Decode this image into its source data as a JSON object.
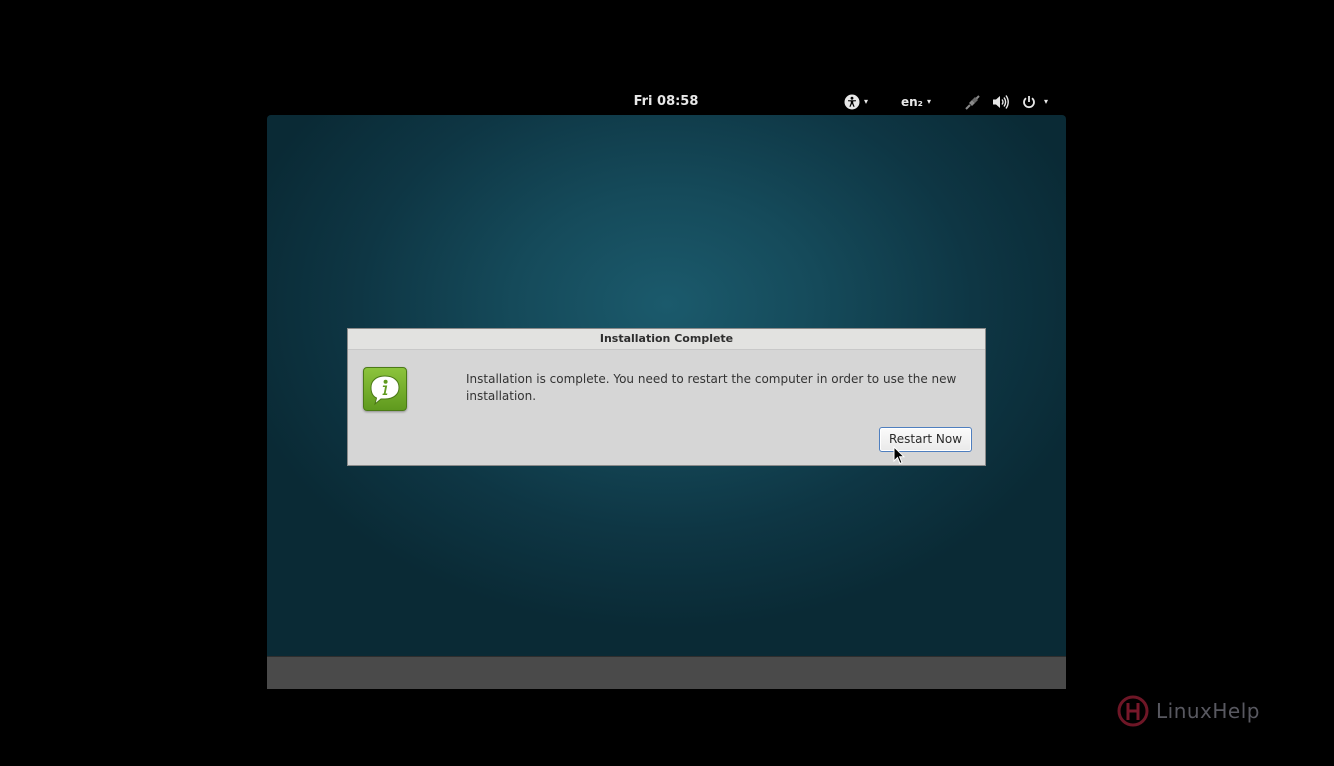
{
  "topbar": {
    "clock": "Fri 08:58",
    "accessibility_icon": "accessibility-icon",
    "language": "en₂",
    "network_icon": "network-disconnected-icon",
    "volume_icon": "volume-icon",
    "power_icon": "power-icon",
    "caret": "▾"
  },
  "dialog": {
    "title": "Installation Complete",
    "icon": "info-speech-bubble-icon",
    "message": "Installation is complete. You need to restart the computer in order to use the new installation.",
    "restart_button": "Restart Now"
  },
  "watermark": {
    "text": "LinuxHelp",
    "logo": "linuxhelp-logo"
  },
  "colors": {
    "desktop_bg": "#154a5a",
    "dialog_bg": "#d6d6d6",
    "icon_green": "#7ab32e",
    "button_border": "#4f7fbf"
  }
}
